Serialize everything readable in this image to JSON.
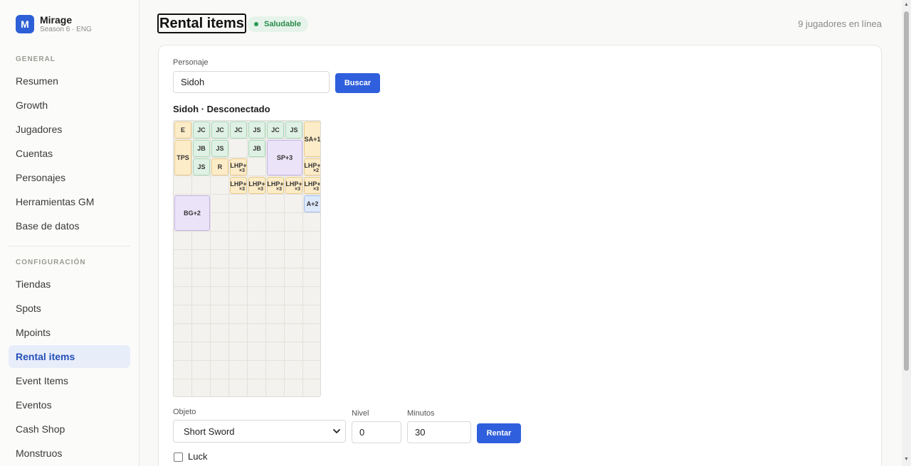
{
  "brand": {
    "logo_letter": "M",
    "name": "Mirage",
    "subtitle": "Season 6 · ENG"
  },
  "sidebar": {
    "general_title": "GENERAL",
    "general_items": [
      {
        "label": "Resumen"
      },
      {
        "label": "Growth"
      },
      {
        "label": "Jugadores"
      },
      {
        "label": "Cuentas"
      },
      {
        "label": "Personajes"
      },
      {
        "label": "Herramientas GM"
      },
      {
        "label": "Base de datos"
      }
    ],
    "config_title": "CONFIGURACIÓN",
    "config_items": [
      {
        "label": "Tiendas"
      },
      {
        "label": "Spots"
      },
      {
        "label": "Mpoints"
      },
      {
        "label": "Rental items",
        "active": true
      },
      {
        "label": "Event Items"
      },
      {
        "label": "Eventos"
      },
      {
        "label": "Cash Shop"
      },
      {
        "label": "Monstruos"
      }
    ]
  },
  "header": {
    "title": "Rental items",
    "status": "Saludable",
    "online": "9 jugadores en línea"
  },
  "search": {
    "label": "Personaje",
    "value": "Sidoh",
    "button": "Buscar"
  },
  "character": {
    "title": "Sidoh · Desconectado"
  },
  "inventory": {
    "columns": 8,
    "rows": 15,
    "items": [
      {
        "label": "E",
        "col": 0,
        "row": 0,
        "w": 1,
        "h": 1,
        "color": "orange"
      },
      {
        "label": "JC",
        "col": 1,
        "row": 0,
        "w": 1,
        "h": 1,
        "color": "green"
      },
      {
        "label": "JC",
        "col": 2,
        "row": 0,
        "w": 1,
        "h": 1,
        "color": "green"
      },
      {
        "label": "JC",
        "col": 3,
        "row": 0,
        "w": 1,
        "h": 1,
        "color": "green"
      },
      {
        "label": "JS",
        "col": 4,
        "row": 0,
        "w": 1,
        "h": 1,
        "color": "green"
      },
      {
        "label": "JC",
        "col": 5,
        "row": 0,
        "w": 1,
        "h": 1,
        "color": "green"
      },
      {
        "label": "JS",
        "col": 6,
        "row": 0,
        "w": 1,
        "h": 1,
        "color": "green"
      },
      {
        "label": "SA+1",
        "col": 7,
        "row": 0,
        "w": 1,
        "h": 2,
        "color": "orange"
      },
      {
        "label": "TPS",
        "col": 0,
        "row": 1,
        "w": 1,
        "h": 2,
        "color": "orange"
      },
      {
        "label": "JB",
        "col": 1,
        "row": 1,
        "w": 1,
        "h": 1,
        "color": "green"
      },
      {
        "label": "JS",
        "col": 2,
        "row": 1,
        "w": 1,
        "h": 1,
        "color": "green"
      },
      {
        "label": "JB",
        "col": 4,
        "row": 1,
        "w": 1,
        "h": 1,
        "color": "green"
      },
      {
        "label": "SP+3",
        "col": 5,
        "row": 1,
        "w": 2,
        "h": 2,
        "color": "purple"
      },
      {
        "label": "JS",
        "col": 1,
        "row": 2,
        "w": 1,
        "h": 1,
        "color": "green"
      },
      {
        "label": "R",
        "col": 2,
        "row": 2,
        "w": 1,
        "h": 1,
        "color": "orange"
      },
      {
        "label": "LHP+",
        "qty": "×3",
        "col": 3,
        "row": 2,
        "w": 1,
        "h": 1,
        "color": "orange"
      },
      {
        "label": "LHP+",
        "qty": "×2",
        "col": 7,
        "row": 2,
        "w": 1,
        "h": 1,
        "color": "orange"
      },
      {
        "label": "LHP+",
        "qty": "×3",
        "col": 3,
        "row": 3,
        "w": 1,
        "h": 1,
        "color": "orange"
      },
      {
        "label": "LHP+",
        "qty": "×3",
        "col": 4,
        "row": 3,
        "w": 1,
        "h": 1,
        "color": "orange"
      },
      {
        "label": "LHP+",
        "qty": "×3",
        "col": 5,
        "row": 3,
        "w": 1,
        "h": 1,
        "color": "orange"
      },
      {
        "label": "LHP+",
        "qty": "×3",
        "col": 6,
        "row": 3,
        "w": 1,
        "h": 1,
        "color": "orange"
      },
      {
        "label": "LHP+",
        "qty": "×3",
        "col": 7,
        "row": 3,
        "w": 1,
        "h": 1,
        "color": "orange"
      },
      {
        "label": "BG+2",
        "col": 0,
        "row": 4,
        "w": 2,
        "h": 2,
        "color": "purple"
      },
      {
        "label": "A+2",
        "col": 7,
        "row": 4,
        "w": 1,
        "h": 1,
        "color": "blue"
      }
    ]
  },
  "rent_form": {
    "item_label": "Objeto",
    "item_value": "Short Sword",
    "level_label": "Nivel",
    "level_value": "0",
    "minutes_label": "Minutos",
    "minutes_value": "30",
    "button": "Rentar",
    "luck_label": "Luck"
  },
  "colors": {
    "accent": "#2f5fdc",
    "healthy": "#2a8a4b"
  }
}
